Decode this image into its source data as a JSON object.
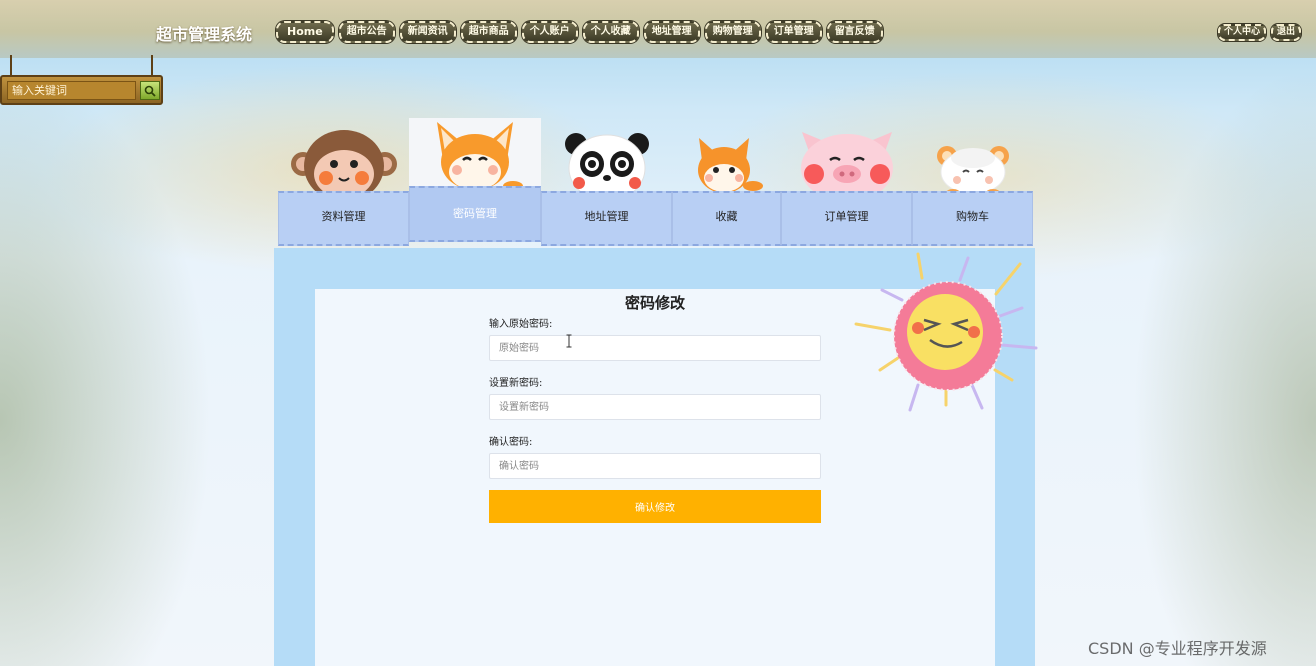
{
  "app": {
    "title": "超市管理系统"
  },
  "nav": {
    "items": [
      "Home",
      "超市公告",
      "新闻资讯",
      "超市商品",
      "个人账户",
      "个人收藏",
      "地址管理",
      "购物管理",
      "订单管理",
      "留言反馈"
    ]
  },
  "user_nav": {
    "items": [
      "个人中心",
      "退出"
    ]
  },
  "search": {
    "placeholder": "输入关键词"
  },
  "tabs": [
    {
      "label": "资料管理",
      "icon": "monkey-icon"
    },
    {
      "label": "密码管理",
      "icon": "fox-icon",
      "active": true
    },
    {
      "label": "地址管理",
      "icon": "panda-icon"
    },
    {
      "label": "收藏",
      "icon": "fox-small-icon"
    },
    {
      "label": "订单管理",
      "icon": "pig-icon"
    },
    {
      "label": "购物车",
      "icon": "sheep-icon"
    }
  ],
  "form": {
    "title": "密码修改",
    "old_password": {
      "label": "输入原始密码:",
      "placeholder": "原始密码"
    },
    "new_password": {
      "label": "设置新密码:",
      "placeholder": "设置新密码"
    },
    "confirm_password": {
      "label": "确认密码:",
      "placeholder": "确认密码"
    },
    "submit_label": "确认修改"
  },
  "watermark": "CSDN @专业程序开发源",
  "colors": {
    "accent": "#ffb100",
    "panel": "#b5dcf7",
    "tab": "#b8cff4"
  }
}
